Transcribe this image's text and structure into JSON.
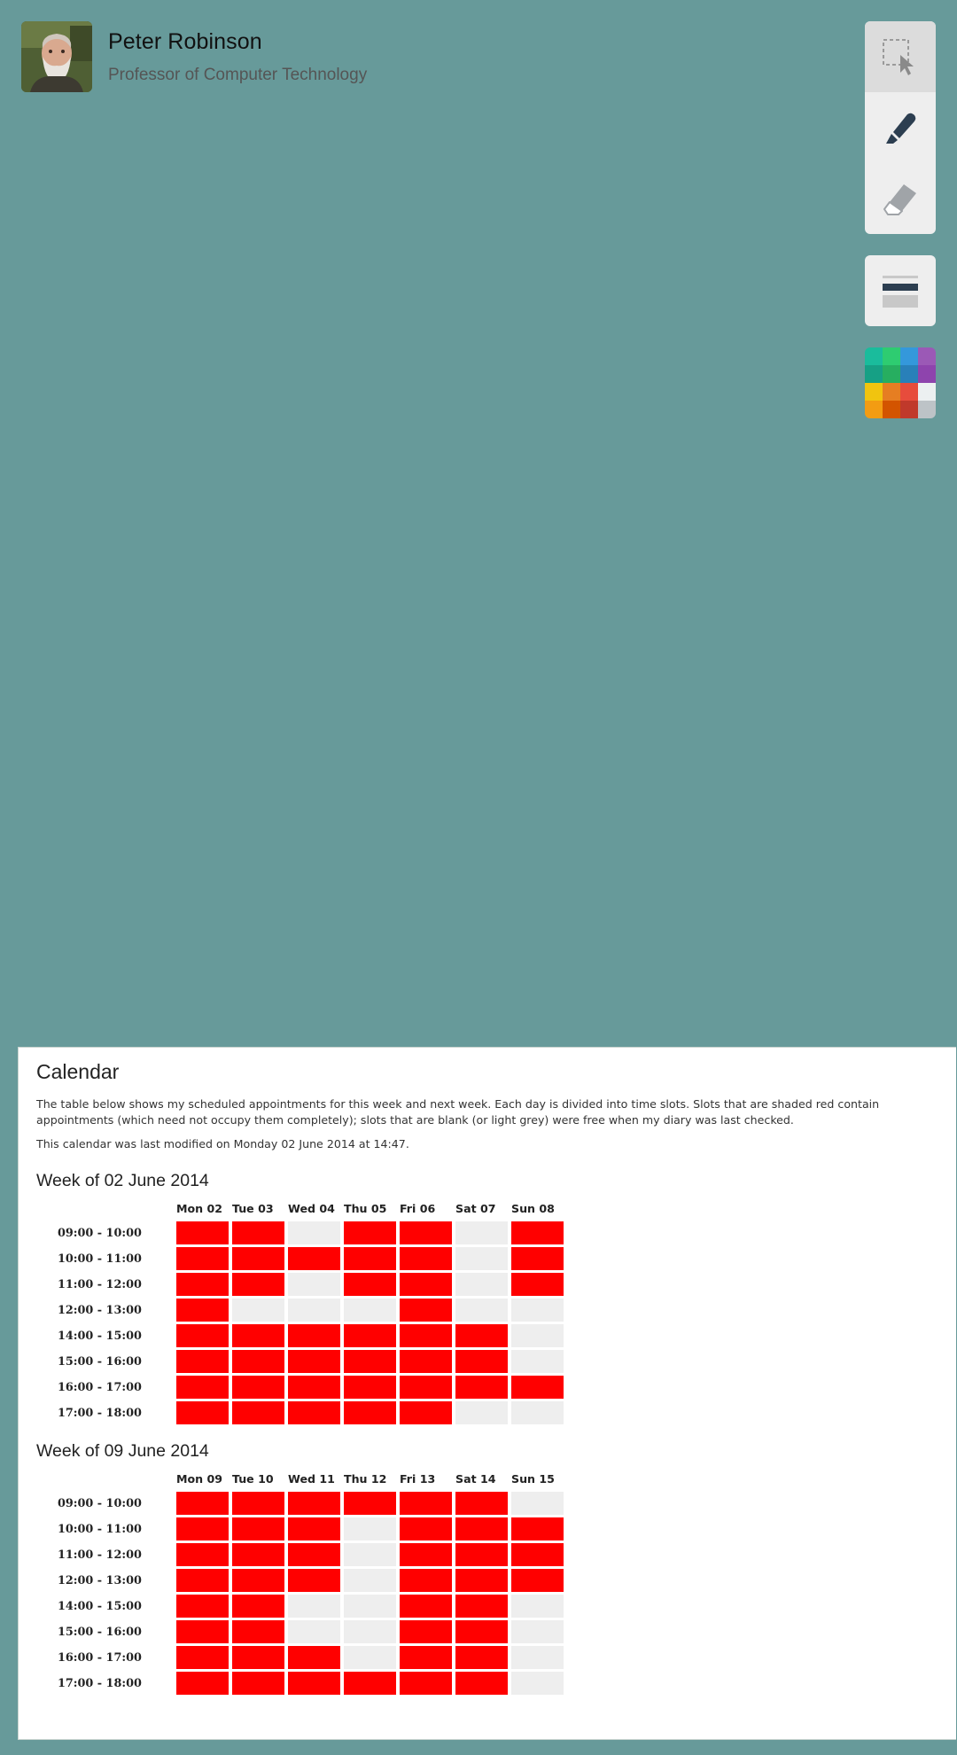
{
  "profile": {
    "name": "Peter Robinson",
    "title": "Professor of Computer Technology"
  },
  "toolbar": {
    "tools": [
      {
        "name": "select-tool",
        "icon": "selection-cursor-icon",
        "active": true
      },
      {
        "name": "pen-tool",
        "icon": "marker-icon",
        "active": false
      },
      {
        "name": "eraser-tool",
        "icon": "eraser-icon",
        "active": false
      }
    ],
    "stroke_tool": {
      "icon": "line-weight-icon"
    },
    "palette": [
      "#1abc9c",
      "#2ecc71",
      "#3498db",
      "#9b59b6",
      "#16a085",
      "#27ae60",
      "#2980b9",
      "#8e44ad",
      "#f1c40f",
      "#e67e22",
      "#e74c3c",
      "#ecf0f1",
      "#f39c12",
      "#d35400",
      "#c0392b",
      "#bdc3c7"
    ]
  },
  "calendar": {
    "heading": "Calendar",
    "description": "The table below shows my scheduled appointments for this week and next week. Each day is divided into time slots. Slots that are shaded red contain appointments (which need not occupy them completely); slots that are blank (or light grey) were free when my diary was last checked.",
    "modified": "This calendar was last modified on Monday 02 June 2014 at 14:47.",
    "colors": {
      "busy": "#ff0000",
      "free": "#eeeeee"
    },
    "slots": [
      "09:00 - 10:00",
      "10:00 - 11:00",
      "11:00 - 12:00",
      "12:00 - 13:00",
      "14:00 - 15:00",
      "15:00 - 16:00",
      "16:00 - 17:00",
      "17:00 - 18:00"
    ],
    "weeks": [
      {
        "title": "Week of 02 June 2014",
        "days": [
          "Mon 02",
          "Tue 03",
          "Wed 04",
          "Thu 05",
          "Fri 06",
          "Sat 07",
          "Sun 08"
        ],
        "busy": [
          [
            1,
            1,
            0,
            1,
            1,
            0,
            1
          ],
          [
            1,
            1,
            1,
            1,
            1,
            0,
            1
          ],
          [
            1,
            1,
            0,
            1,
            1,
            0,
            1
          ],
          [
            1,
            0,
            0,
            0,
            1,
            0,
            0
          ],
          [
            1,
            1,
            1,
            1,
            1,
            1,
            0
          ],
          [
            1,
            1,
            1,
            1,
            1,
            1,
            0
          ],
          [
            1,
            1,
            1,
            1,
            1,
            1,
            1
          ],
          [
            1,
            1,
            1,
            1,
            1,
            0,
            0
          ]
        ]
      },
      {
        "title": "Week of 09 June 2014",
        "days": [
          "Mon 09",
          "Tue 10",
          "Wed 11",
          "Thu 12",
          "Fri 13",
          "Sat 14",
          "Sun 15"
        ],
        "busy": [
          [
            1,
            1,
            1,
            1,
            1,
            1,
            0
          ],
          [
            1,
            1,
            1,
            0,
            1,
            1,
            1
          ],
          [
            1,
            1,
            1,
            0,
            1,
            1,
            1
          ],
          [
            1,
            1,
            1,
            0,
            1,
            1,
            1
          ],
          [
            1,
            1,
            0,
            0,
            1,
            1,
            0
          ],
          [
            1,
            1,
            0,
            0,
            1,
            1,
            0
          ],
          [
            1,
            1,
            1,
            0,
            1,
            1,
            0
          ],
          [
            1,
            1,
            1,
            1,
            1,
            1,
            0
          ]
        ]
      }
    ]
  }
}
